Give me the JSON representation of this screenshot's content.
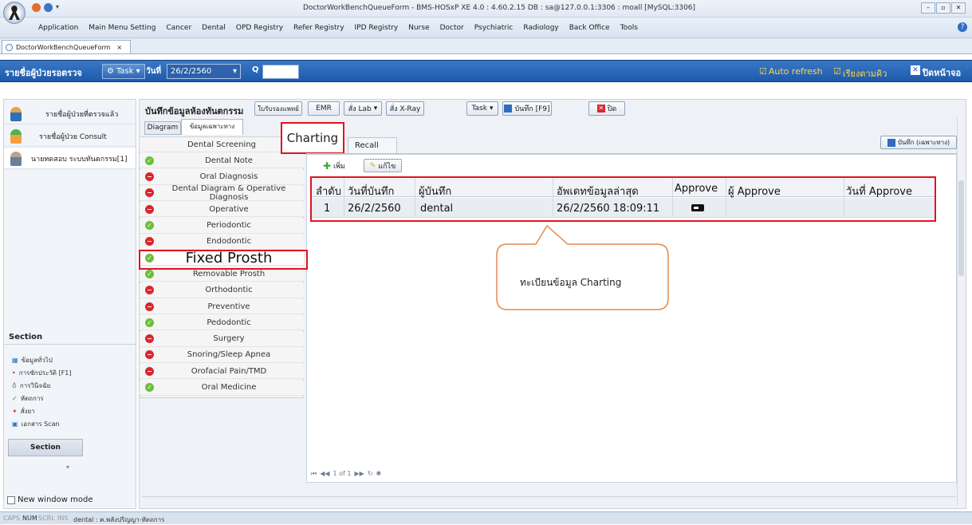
{
  "window": {
    "title": "DoctorWorkBenchQueueForm - BMS-HOSxP XE 4.0 : 4.60.2.15 DB : sa@127.0.0.1:3306 : moall [MySQL:3306]"
  },
  "menu": [
    "Application",
    "Main Menu Setting",
    "Cancer",
    "Dental",
    "OPD Registry",
    "Refer Registry",
    "IPD Registry",
    "Nurse",
    "Doctor",
    "Psychiatric",
    "Radiology",
    "Back Office",
    "Tools"
  ],
  "doc_tab": {
    "label": "DoctorWorkBenchQueueForm",
    "close": "×"
  },
  "toolbar": {
    "title": "รายชื่อผู้ป่วยรอตรวจ",
    "task_label": "Task",
    "date_label": "วันที่",
    "date_value": "26/2/2560",
    "q_label": "Q",
    "q_value": "",
    "auto_refresh": "Auto refresh",
    "queue_order": "เรียงตามคิว",
    "close_screen": "ปิดหน้าจอ"
  },
  "left_panel": {
    "items": [
      "รายชื่อผู้ป่วยที่ตรวจแล้ว",
      "รายชื่อผู้ป่วย Consult",
      "นายทดสอบ ระบบทันตกรรม[1]"
    ],
    "section_title": "Section",
    "section_items": [
      "ข้อมูลทั่วไป",
      "การซักประวัติ [F1]",
      "การวินิจฉัย",
      "หัตถการ",
      "สั่งยา",
      "เอกสาร Scan"
    ],
    "section_button": "Section",
    "new_window": "New window mode"
  },
  "record": {
    "title": "บันทึกข้อมูลห้องทันตกรรม",
    "buttons": {
      "doctor_cert": "ใบรับรองแพทย์",
      "emr": "EMR",
      "lab": "สั่ง Lab",
      "xray": "สั่ง X-Ray",
      "task": "Task",
      "save": "บันทึก [F9]",
      "close": "ปิด"
    },
    "tabs": [
      "Diagram",
      "ข้อมูลเฉพาะทาง"
    ],
    "specialty_tabs": [
      "Charting",
      "Recall"
    ],
    "save_specific": "บันทึก (เฉพาะทาง)"
  },
  "dental_list": [
    {
      "label": "Dental Screening",
      "status": "none"
    },
    {
      "label": "Dental Note",
      "status": "ok"
    },
    {
      "label": "Oral Diagnosis",
      "status": "no"
    },
    {
      "label": "Dental Diagram & Operative Diagnosis",
      "status": "no"
    },
    {
      "label": "Operative",
      "status": "no"
    },
    {
      "label": "Periodontic",
      "status": "ok"
    },
    {
      "label": "Endodontic",
      "status": "no"
    },
    {
      "label": "Fixed Prosth",
      "status": "ok"
    },
    {
      "label": "Removable Prosth",
      "status": "ok"
    },
    {
      "label": "Orthodontic",
      "status": "no"
    },
    {
      "label": "Preventive",
      "status": "no"
    },
    {
      "label": "Pedodontic",
      "status": "ok"
    },
    {
      "label": "Surgery",
      "status": "no"
    },
    {
      "label": "Snoring/Sleep Apnea",
      "status": "no"
    },
    {
      "label": "Orofacial Pain/TMD",
      "status": "no"
    },
    {
      "label": "Oral Medicine",
      "status": "ok"
    }
  ],
  "grid_toolbar": {
    "add": "เพิ่ม",
    "edit": "แก้ไข"
  },
  "grid": {
    "headers": [
      "ลำดับ",
      "วันที่บันทึก",
      "ผู้บันทึก",
      "อัพเดทข้อมูลล่าสุด",
      "Approve",
      "ผู้ Approve",
      "วันที่ Approve"
    ],
    "rows": [
      [
        "1",
        "26/2/2560",
        "dental",
        "26/2/2560 18:09:11",
        "",
        "",
        ""
      ]
    ],
    "nav": "1 of 1"
  },
  "callout": {
    "text": "ทะเบียนข้อมูล Charting"
  },
  "status_bar": {
    "caps": "CAPS",
    "num": "NUM",
    "scrl": "SCRL",
    "ins": "INS",
    "user": "dental : ค.พลังปริญญา-หัตถการ"
  }
}
